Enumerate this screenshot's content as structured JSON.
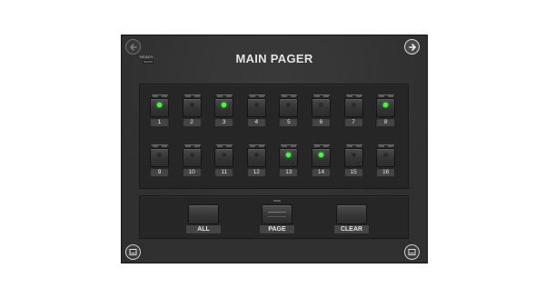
{
  "app": {
    "title": "MAIN PAGER",
    "ready_label": "READY"
  },
  "nav": {
    "back_icon": "arrow-left-icon",
    "next_icon": "arrow-right-icon",
    "bottom_left_icon": "keyboard-icon",
    "bottom_right_icon": "keyboard-icon"
  },
  "pads": [
    {
      "label": "1",
      "active": true
    },
    {
      "label": "2",
      "active": false
    },
    {
      "label": "3",
      "active": true
    },
    {
      "label": "4",
      "active": false
    },
    {
      "label": "5",
      "active": false
    },
    {
      "label": "6",
      "active": false
    },
    {
      "label": "7",
      "active": false
    },
    {
      "label": "8",
      "active": true
    },
    {
      "label": "9",
      "active": false
    },
    {
      "label": "10",
      "active": false
    },
    {
      "label": "11",
      "active": false
    },
    {
      "label": "12",
      "active": false
    },
    {
      "label": "13",
      "active": true
    },
    {
      "label": "14",
      "active": true
    },
    {
      "label": "15",
      "active": false
    },
    {
      "label": "16",
      "active": false
    }
  ],
  "actions": {
    "all_label": "ALL",
    "page_label": "PAGE",
    "clear_label": "CLEAR"
  },
  "colors": {
    "panel": "#2f2f2f",
    "led_on": "#3dff3d"
  }
}
